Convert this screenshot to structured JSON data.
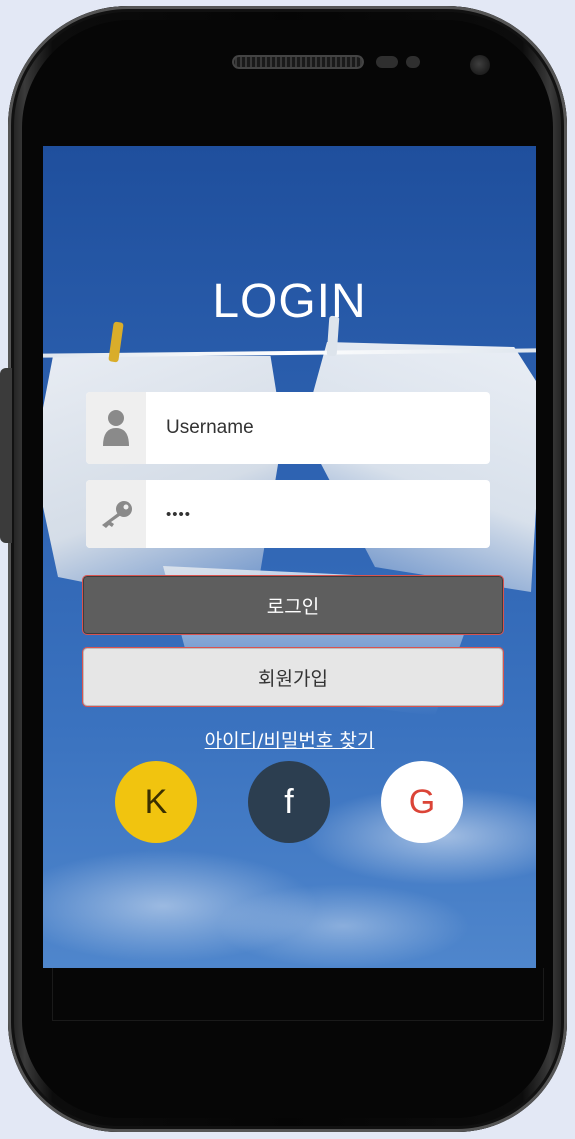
{
  "login": {
    "title": "LOGIN",
    "username_placeholder": "Username",
    "password_value": "••••",
    "login_button": "로그인",
    "signup_button": "회원가입",
    "find_account_link": "아이디/비밀번호 찾기",
    "icons": {
      "username": "user-icon",
      "password": "key-icon"
    }
  },
  "social": [
    {
      "label": "K",
      "icon": "kakao-icon",
      "bg": "#f1c40f",
      "fg": "#3a2f00"
    },
    {
      "label": "f",
      "icon": "facebook-icon",
      "bg": "#2c3e50",
      "fg": "#ffffff"
    },
    {
      "label": "G",
      "icon": "google-icon",
      "bg": "#ffffff",
      "fg": "#db4437"
    }
  ]
}
